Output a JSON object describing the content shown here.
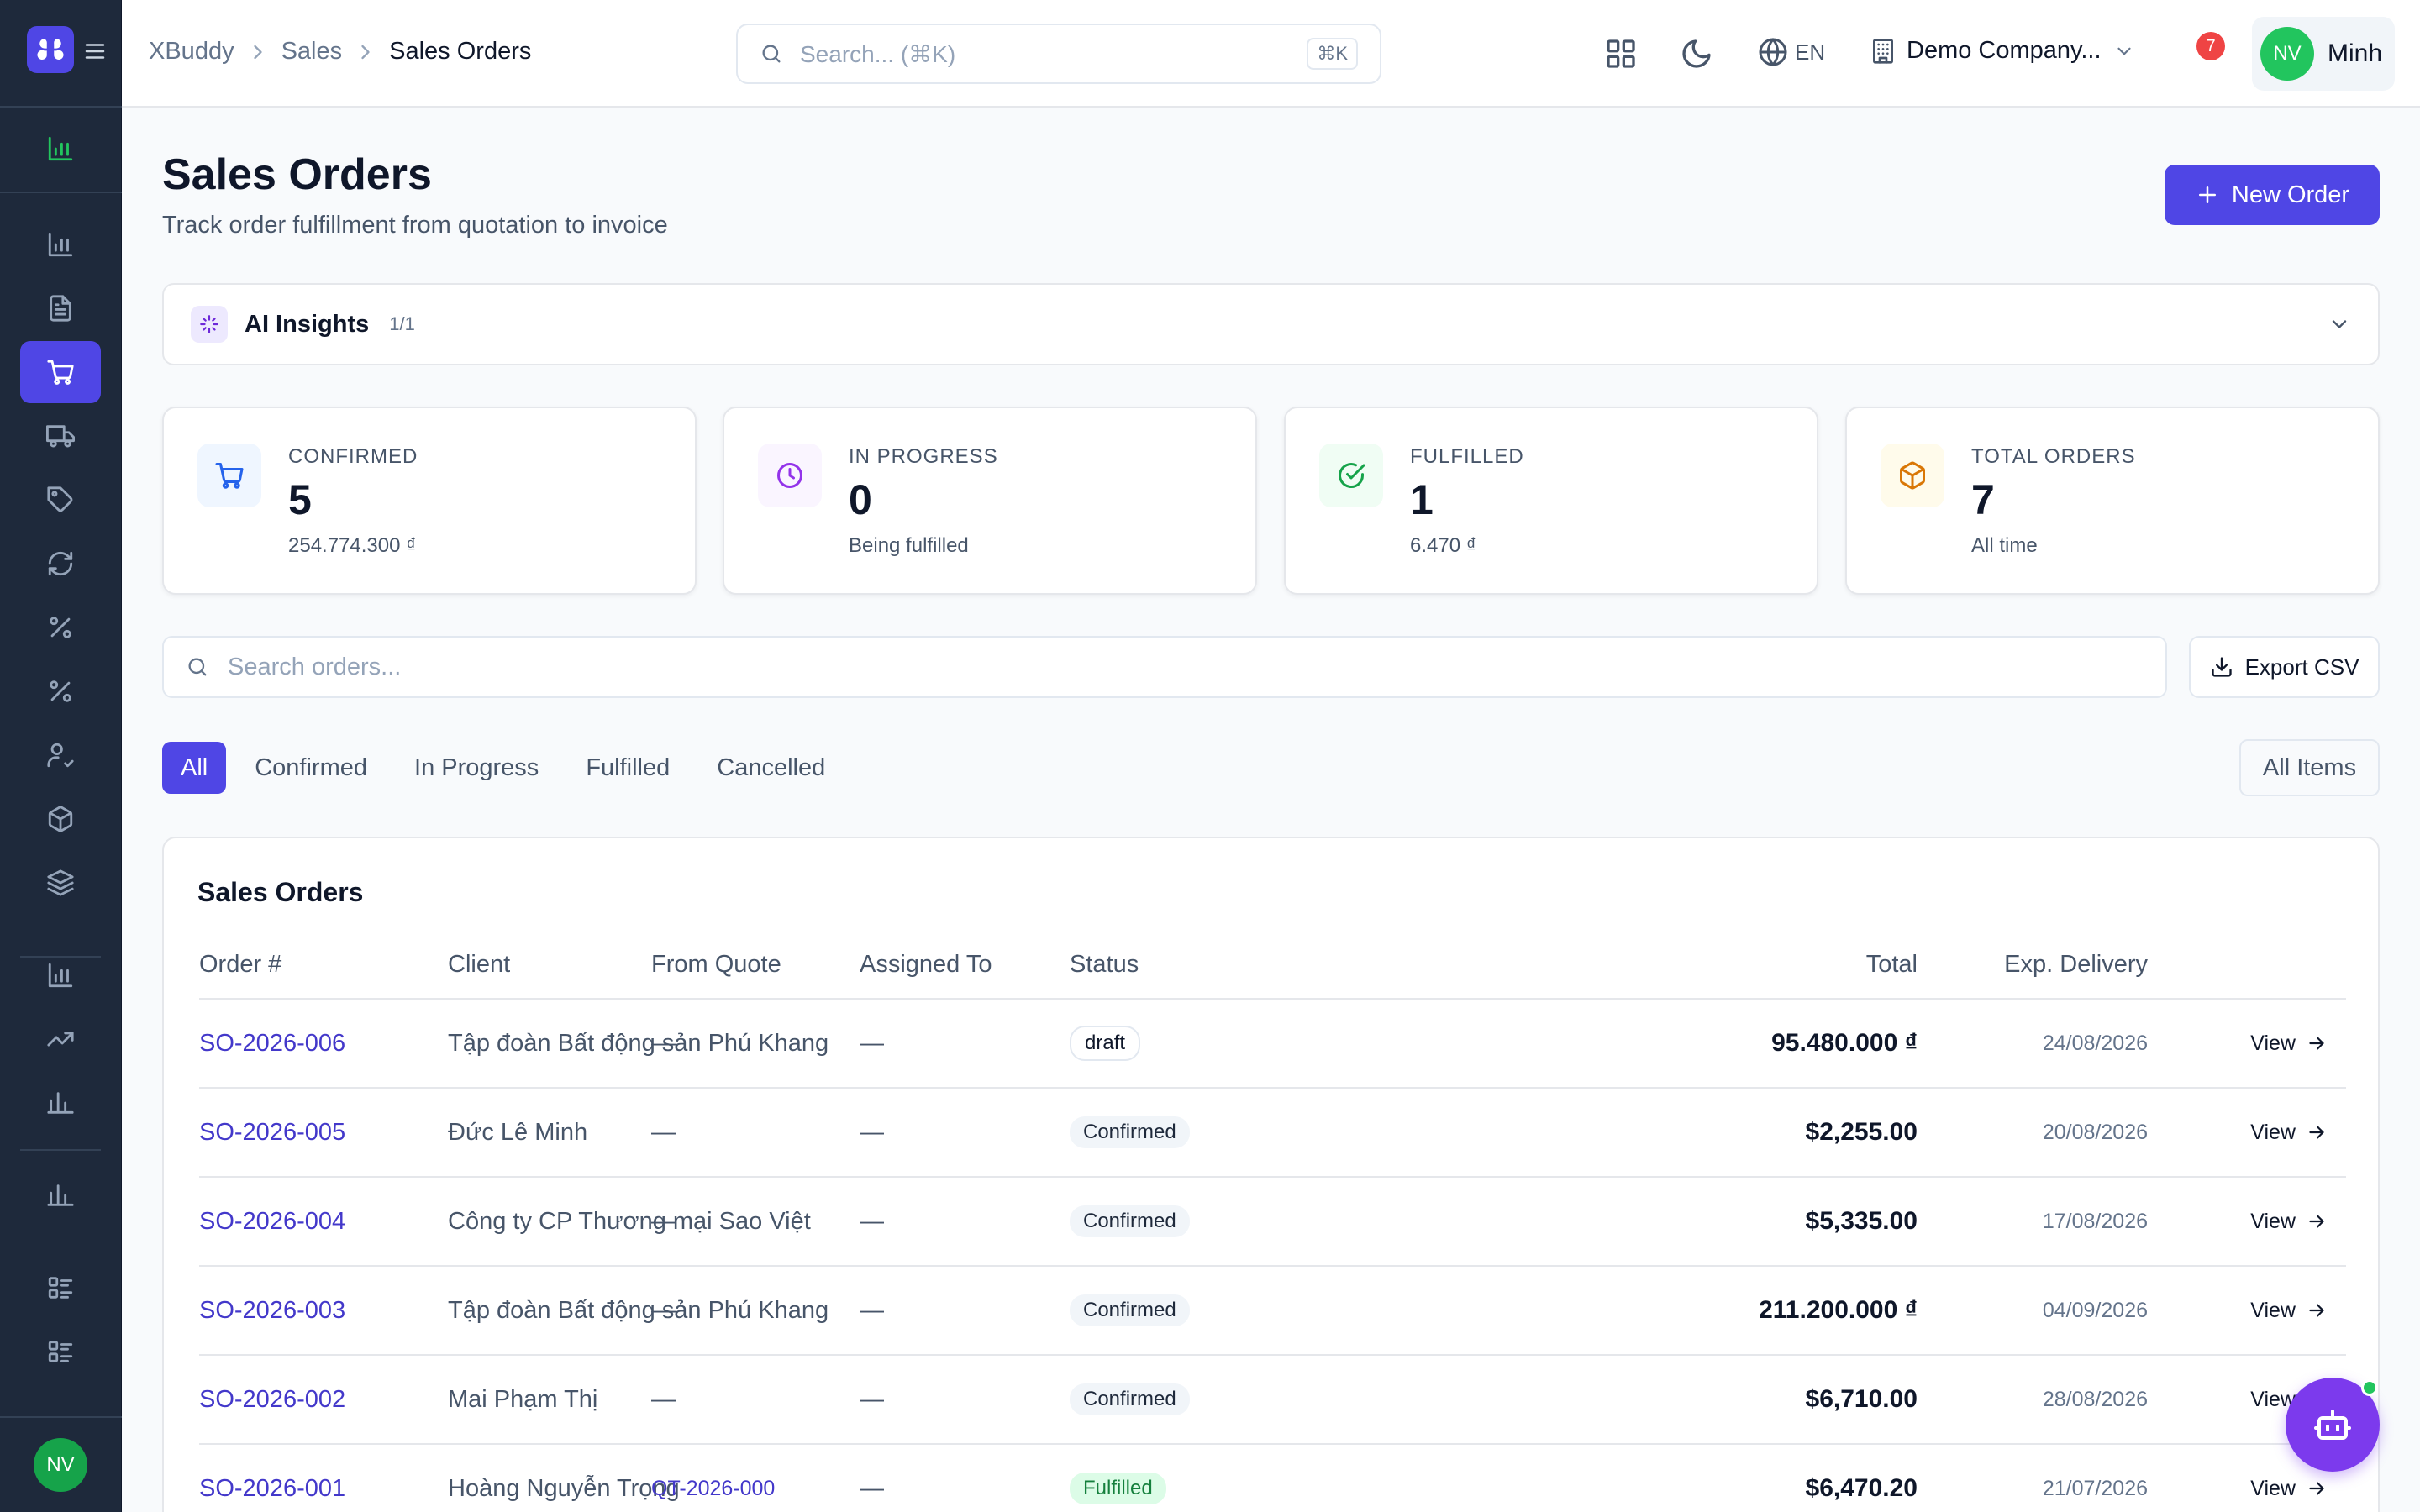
{
  "sidebar": {
    "logo_icon": "app-logo-icon",
    "items": [
      {
        "icon": "bar-chart-icon"
      },
      {
        "icon": "bar-chart-icon"
      },
      {
        "icon": "file-text-icon"
      },
      {
        "icon": "shopping-cart-icon"
      },
      {
        "icon": "truck-icon"
      },
      {
        "icon": "tag-icon"
      },
      {
        "icon": "refresh-icon"
      },
      {
        "icon": "percent-icon"
      },
      {
        "icon": "percent-icon"
      },
      {
        "icon": "user-check-icon"
      },
      {
        "icon": "package-icon"
      },
      {
        "icon": "layers-icon"
      },
      {
        "icon": "bar-chart-icon"
      },
      {
        "icon": "trending-up-icon"
      },
      {
        "icon": "bar-chart-icon"
      },
      {
        "icon": "bar-chart-icon"
      },
      {
        "icon": "list-icon"
      },
      {
        "icon": "list-icon"
      }
    ],
    "avatar_initials": "NV"
  },
  "header": {
    "breadcrumb": [
      "XBuddy",
      "Sales",
      "Sales Orders"
    ],
    "search_placeholder": "Search... (⌘K)",
    "search_shortcut": "⌘K",
    "language": "EN",
    "company": "Demo Company...",
    "notification_count": "7",
    "user_initials": "NV",
    "user_name": "Minh"
  },
  "page": {
    "title": "Sales Orders",
    "subtitle": "Track order fulfillment from quotation to invoice",
    "new_order_label": "New Order"
  },
  "ai_insights": {
    "title": "AI Insights",
    "count": "1/1"
  },
  "stats": [
    {
      "label": "CONFIRMED",
      "value": "5",
      "sub": "254.774.300 ₫",
      "icon": "shopping-cart-icon",
      "color": "#2563eb",
      "bg": "#eff6ff"
    },
    {
      "label": "IN PROGRESS",
      "value": "0",
      "sub": "Being fulfilled",
      "icon": "clock-icon",
      "color": "#9333ea",
      "bg": "#faf5ff"
    },
    {
      "label": "FULFILLED",
      "value": "1",
      "sub": "6.470 ₫",
      "icon": "check-circle-icon",
      "color": "#16a34a",
      "bg": "#f0fdf4"
    },
    {
      "label": "TOTAL ORDERS",
      "value": "7",
      "sub": "All time",
      "icon": "package-icon",
      "color": "#d97706",
      "bg": "#fffbeb"
    }
  ],
  "orders_search": {
    "placeholder": "Search orders...",
    "value": ""
  },
  "export_label": "Export CSV",
  "tabs": [
    {
      "label": "All",
      "active": true
    },
    {
      "label": "Confirmed",
      "active": false
    },
    {
      "label": "In Progress",
      "active": false
    },
    {
      "label": "Fulfilled",
      "active": false
    },
    {
      "label": "Cancelled",
      "active": false
    }
  ],
  "all_items_label": "All Items",
  "table": {
    "title": "Sales Orders",
    "columns": [
      "Order #",
      "Client",
      "From Quote",
      "Assigned To",
      "Status",
      "Total",
      "Exp. Delivery"
    ],
    "rows": [
      {
        "order": "SO-2026-006",
        "client": "Tập đoàn Bất động sản Phú Khang",
        "quote": "—",
        "assigned": "—",
        "status": "draft",
        "status_type": "draft",
        "total": "95.480.000 ₫",
        "delivery": "24/08/2026",
        "action": "View"
      },
      {
        "order": "SO-2026-005",
        "client": "Đức Lê Minh",
        "quote": "—",
        "assigned": "—",
        "status": "Confirmed",
        "status_type": "confirmed",
        "total": "$2,255.00",
        "delivery": "20/08/2026",
        "action": "View"
      },
      {
        "order": "SO-2026-004",
        "client": "Công ty CP Thương mại Sao Việt",
        "quote": "—",
        "assigned": "—",
        "status": "Confirmed",
        "status_type": "confirmed",
        "total": "$5,335.00",
        "delivery": "17/08/2026",
        "action": "View"
      },
      {
        "order": "SO-2026-003",
        "client": "Tập đoàn Bất động sản Phú Khang",
        "quote": "—",
        "assigned": "—",
        "status": "Confirmed",
        "status_type": "confirmed",
        "total": "211.200.000 ₫",
        "delivery": "04/09/2026",
        "action": "View"
      },
      {
        "order": "SO-2026-002",
        "client": "Mai Phạm Thị",
        "quote": "—",
        "assigned": "—",
        "status": "Confirmed",
        "status_type": "confirmed",
        "total": "$6,710.00",
        "delivery": "28/08/2026",
        "action": "View"
      },
      {
        "order": "SO-2026-001",
        "client": "Hoàng Nguyễn Trọng",
        "quote": "QT-2026-000",
        "assigned": "—",
        "status": "Fulfilled",
        "status_type": "fulfilled",
        "total": "$6,470.20",
        "delivery": "21/07/2026",
        "action": "View"
      }
    ]
  },
  "colors": {
    "accent": "#4f46e5",
    "sidebar_bg": "#1e293b",
    "link": "#4338ca"
  }
}
